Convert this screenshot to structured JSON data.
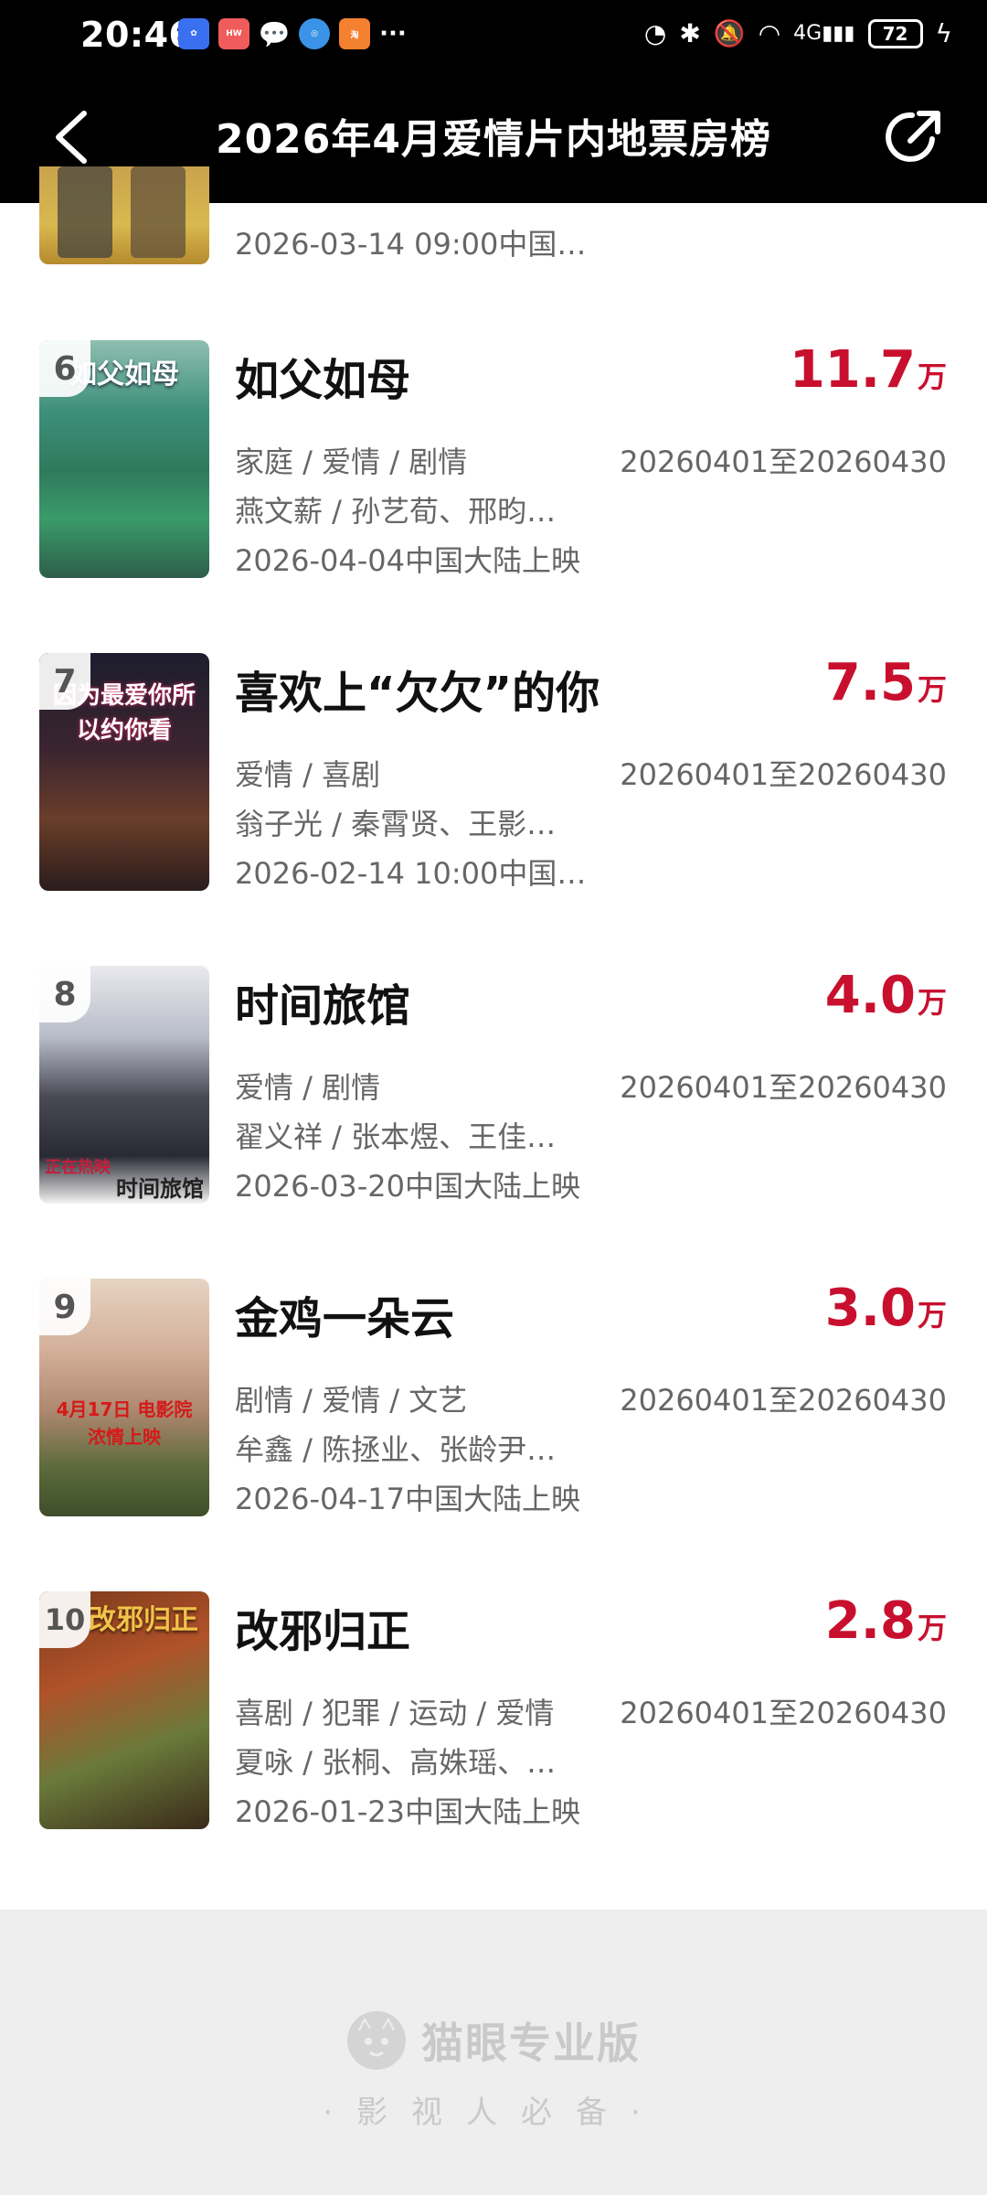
{
  "status_bar": {
    "time": "20:46",
    "battery": "72",
    "network": "4G"
  },
  "header": {
    "title": "2026年4月爱情片内地票房榜"
  },
  "partial_item": {
    "release": "2026-03-14 09:00中国…"
  },
  "movies": [
    {
      "rank": "6",
      "name": "如父如母",
      "boxoffice": "11.7",
      "unit": "万",
      "genre": "家庭 / 爱情 / 剧情",
      "period": "20260401至20260430",
      "cast": "燕文薪 / 孙艺荀、邢昀…",
      "release": "2026-04-04中国大陆上映",
      "poster_title": "如父如母"
    },
    {
      "rank": "7",
      "name": "喜欢上“欠欠”的你",
      "boxoffice": "7.5",
      "unit": "万",
      "genre": "爱情 / 喜剧",
      "period": "20260401至20260430",
      "cast": "翁子光 / 秦霄贤、王影…",
      "release": "2026-02-14 10:00中国…",
      "poster_title": "因为最爱你所以约你看"
    },
    {
      "rank": "8",
      "name": "时间旅馆",
      "boxoffice": "4.0",
      "unit": "万",
      "genre": "爱情 / 剧情",
      "period": "20260401至20260430",
      "cast": "翟义祥 / 张本煜、王佳…",
      "release": "2026-03-20中国大陆上映",
      "poster_title": "时间旅馆",
      "poster_tag": "正在热映"
    },
    {
      "rank": "9",
      "name": "金鸡一朵云",
      "boxoffice": "3.0",
      "unit": "万",
      "genre": "剧情 / 爱情 / 文艺",
      "period": "20260401至20260430",
      "cast": "牟鑫 / 陈拯业、张龄尹…",
      "release": "2026-04-17中国大陆上映",
      "poster_title": "4月17日 电影院 浓情上映"
    },
    {
      "rank": "10",
      "name": "改邪归正",
      "boxoffice": "2.8",
      "unit": "万",
      "genre": "喜剧 / 犯罪 / 运动 / 爱情",
      "period": "20260401至20260430",
      "cast": "夏咏 / 张桐、高姝瑶、…",
      "release": "2026-01-23中国大陆上映",
      "poster_title": "改邪归正"
    }
  ],
  "footer": {
    "brand": "猫眼专业版",
    "slogan": "·影视人必备·"
  },
  "colors": {
    "accent": "#c8102e",
    "header_bg": "#000000",
    "footer_bg": "#eeeeee"
  }
}
